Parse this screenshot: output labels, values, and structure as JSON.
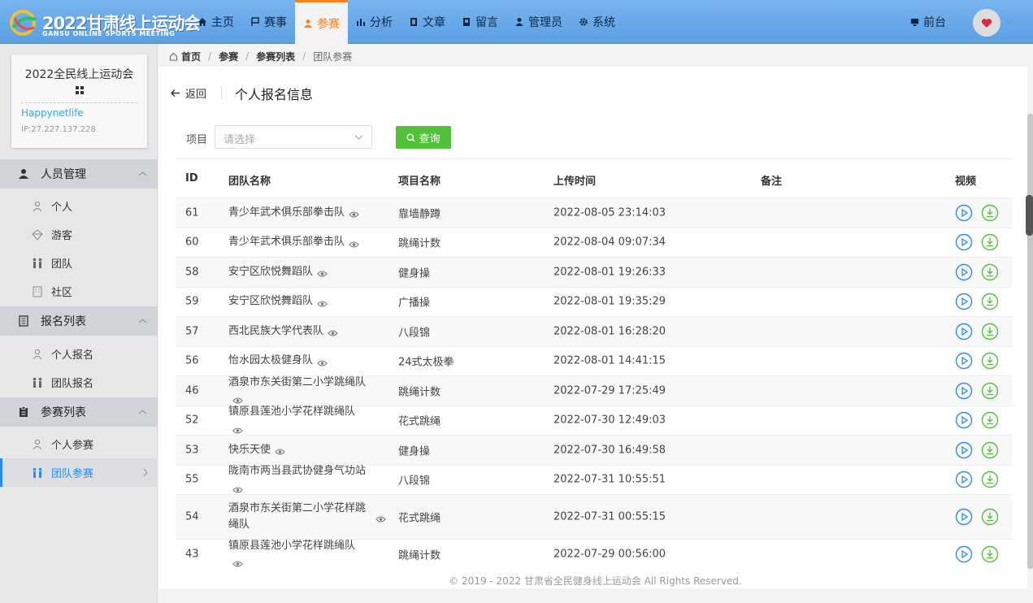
{
  "header": {
    "logo_cn": "2022甘肃线上运动会",
    "logo_en": "GANSU ONLINE SPORTS MEETING",
    "nav": [
      {
        "label": "主页",
        "icon": "home-icon"
      },
      {
        "label": "赛事",
        "icon": "flag-icon"
      },
      {
        "label": "参赛",
        "icon": "user-icon",
        "active": true
      },
      {
        "label": "分析",
        "icon": "bar-chart-icon"
      },
      {
        "label": "文章",
        "icon": "document-icon"
      },
      {
        "label": "留言",
        "icon": "message-icon"
      },
      {
        "label": "管理员",
        "icon": "admin-icon"
      },
      {
        "label": "系统",
        "icon": "gear-icon"
      }
    ],
    "front_label": "前台",
    "accent_color": "#ff7f1a"
  },
  "sidebar": {
    "card_title": "2022全民线上运动会",
    "username": "Happynetlife",
    "ip": "IP:27.227.137.228",
    "sections": [
      {
        "label": "人员管理",
        "items": [
          "个人",
          "游客",
          "团队",
          "社区"
        ]
      },
      {
        "label": "报名列表",
        "items": [
          "个人报名",
          "团队报名"
        ]
      },
      {
        "label": "参赛列表",
        "items": [
          "个人参赛",
          "团队参赛"
        ]
      }
    ]
  },
  "breadcrumb": {
    "home": "首页",
    "b1": "参赛",
    "b2": "参赛列表",
    "current": "团队参赛"
  },
  "page": {
    "back_label": "返回",
    "title": "个人报名信息",
    "filter_label": "项目",
    "select_placeholder": "请选择",
    "query_label": "查询"
  },
  "table": {
    "headers": {
      "id": "ID",
      "team": "团队名称",
      "project": "项目名称",
      "time": "上传时间",
      "note": "备注",
      "video": "视频"
    },
    "rows": [
      {
        "id": "61",
        "team": "青少年武术俱乐部拳击队",
        "project": "靠墙静蹲",
        "time": "2022-08-05 23:14:03"
      },
      {
        "id": "60",
        "team": "青少年武术俱乐部拳击队",
        "project": "跳绳计数",
        "time": "2022-08-04 09:07:34"
      },
      {
        "id": "58",
        "team": "安宁区欣悦舞蹈队",
        "project": "健身操",
        "time": "2022-08-01 19:26:33"
      },
      {
        "id": "59",
        "team": "安宁区欣悦舞蹈队",
        "project": "广播操",
        "time": "2022-08-01 19:35:29"
      },
      {
        "id": "57",
        "team": "西北民族大学代表队",
        "project": "八段锦",
        "time": "2022-08-01 16:28:20"
      },
      {
        "id": "56",
        "team": "怡水园太极健身队",
        "project": "24式太极拳",
        "time": "2022-08-01 14:41:15"
      },
      {
        "id": "46",
        "team": "酒泉市东关街第二小学跳绳队",
        "project": "跳绳计数",
        "time": "2022-07-29 17:25:49"
      },
      {
        "id": "52",
        "team": "镇原县莲池小学花样跳绳队",
        "project": "花式跳绳",
        "time": "2022-07-30 12:49:03"
      },
      {
        "id": "53",
        "team": "快乐天使",
        "project": "健身操",
        "time": "2022-07-30 16:49:58"
      },
      {
        "id": "55",
        "team": "陇南市两当县武协健身气功站",
        "project": "八段锦",
        "time": "2022-07-31 10:55:51"
      },
      {
        "id": "54",
        "team": "酒泉市东关街第二小学花样跳绳队",
        "project": "花式跳绳",
        "time": "2022-07-31 00:55:15",
        "wrap": true
      },
      {
        "id": "43",
        "team": "镇原县莲池小学花样跳绳队",
        "project": "跳绳计数",
        "time": "2022-07-29 00:56:00"
      }
    ]
  },
  "footer": "© 2019 - 2022 甘肃省全民健身线上运动会 All Rights Reserved."
}
